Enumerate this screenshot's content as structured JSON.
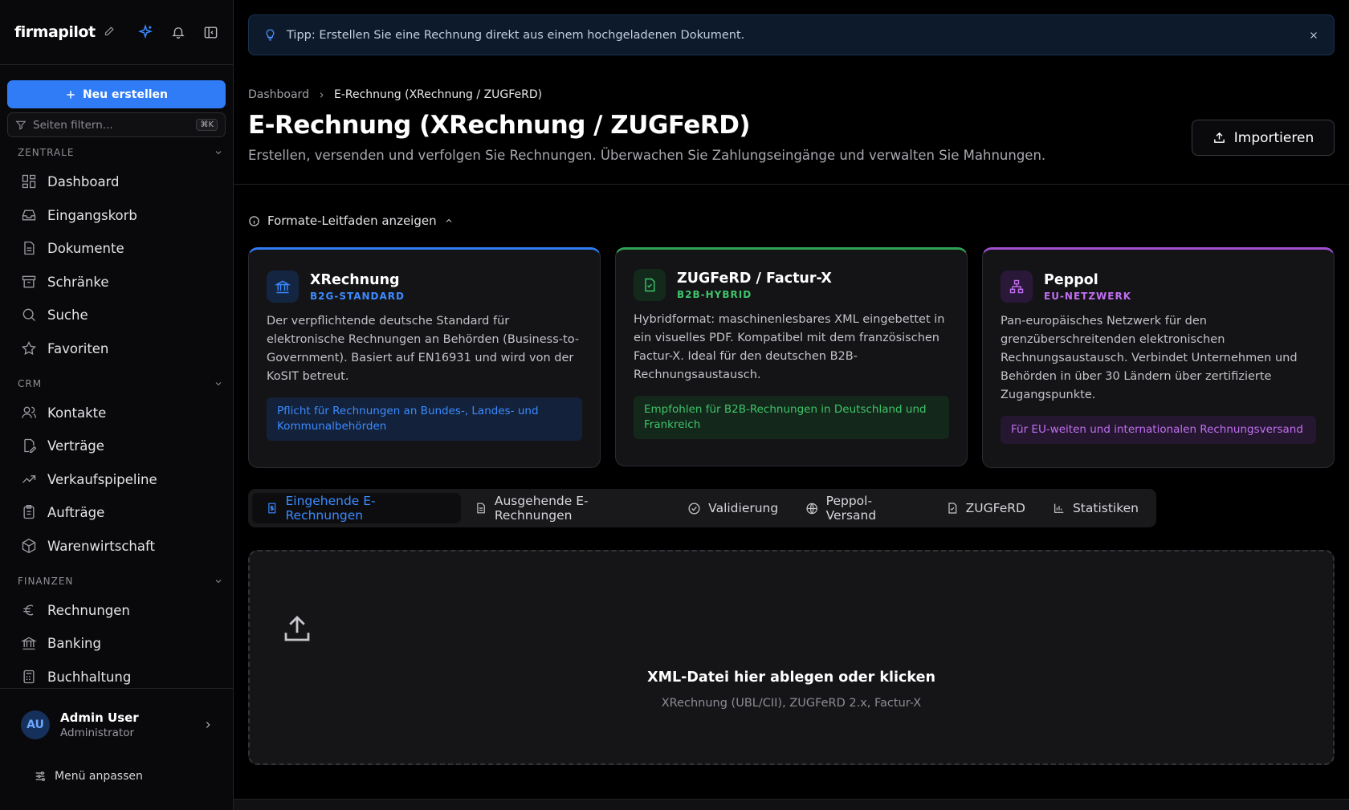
{
  "sidebar": {
    "brand": "firmapilot",
    "new_button": "Neu erstellen",
    "filter_placeholder": "Seiten filtern...",
    "filter_shortcut": "⌘K",
    "sections": [
      {
        "label": "ZENTRALE",
        "items": [
          "Dashboard",
          "Eingangskorb",
          "Dokumente",
          "Schränke",
          "Suche",
          "Favoriten"
        ]
      },
      {
        "label": "CRM",
        "items": [
          "Kontakte",
          "Verträge",
          "Verkaufspipeline",
          "Aufträge",
          "Warenwirtschaft"
        ]
      },
      {
        "label": "FINANZEN",
        "items": [
          "Rechnungen",
          "Banking",
          "Buchhaltung"
        ]
      }
    ],
    "user": {
      "initials": "AU",
      "name": "Admin User",
      "role": "Administrator"
    },
    "customize": "Menü anpassen"
  },
  "tip": {
    "text": "Tipp: Erstellen Sie eine Rechnung direkt aus einem hochgeladenen Dokument."
  },
  "breadcrumb": {
    "root": "Dashboard",
    "current": "E-Rechnung (XRechnung / ZUGFeRD)"
  },
  "page": {
    "title": "E-Rechnung (XRechnung / ZUGFeRD)",
    "subtitle": "Erstellen, versenden und verfolgen Sie Rechnungen. Überwachen Sie Zahlungseingänge und verwalten Sie Mahnungen.",
    "import_button": "Importieren",
    "guide_toggle": "Formate-Leitfaden anzeigen"
  },
  "cards": [
    {
      "title": "XRechnung",
      "tag": "B2G-STANDARD",
      "desc": "Der verpflichtende deutsche Standard für elektronische Rechnungen an Behörden (Business-to-Government). Basiert auf EN16931 und wird von der KoSIT betreut.",
      "note": "Pflicht für Rechnungen an Bundes-, Landes- und Kommunalbehörden"
    },
    {
      "title": "ZUGFeRD / Factur-X",
      "tag": "B2B-HYBRID",
      "desc": "Hybridformat: maschinenlesbares XML eingebettet in ein visuelles PDF. Kompatibel mit dem französischen Factur-X. Ideal für den deutschen B2B-Rechnungsaustausch.",
      "note": "Empfohlen für B2B-Rechnungen in Deutschland und Frankreich"
    },
    {
      "title": "Peppol",
      "tag": "EU-NETZWERK",
      "desc": "Pan-europäisches Netzwerk für den grenzüberschreitenden elektronischen Rechnungsaustausch. Verbindet Unternehmen und Behörden in über 30 Ländern über zertifizierte Zugangspunkte.",
      "note": "Für EU-weiten und internationalen Rechnungsversand"
    }
  ],
  "tabs": [
    "Eingehende E-Rechnungen",
    "Ausgehende E-Rechnungen",
    "Validierung",
    "Peppol-Versand",
    "ZUGFeRD",
    "Statistiken"
  ],
  "dropzone": {
    "title": "XML-Datei hier ablegen oder klicken",
    "formats": "XRechnung (UBL/CII), ZUGFeRD 2.x, Factur-X"
  },
  "colors": {
    "accent": "#2f7cf6",
    "green": "#2ea355",
    "purple": "#a24fd0"
  }
}
